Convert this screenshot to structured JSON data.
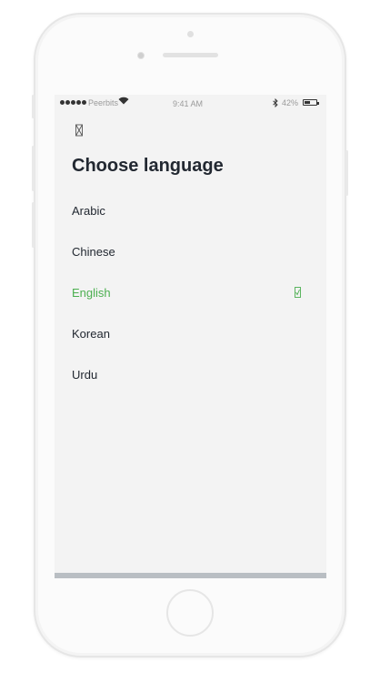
{
  "status_bar": {
    "carrier": "Peerbits",
    "time": "9:41 AM",
    "battery": "42%",
    "bluetooth_icon": "bluetooth-icon",
    "wifi_icon": "wifi-icon"
  },
  "nav": {
    "back_icon": "back-icon"
  },
  "page": {
    "title": "Choose language"
  },
  "languages": [
    {
      "label": "Arabic",
      "selected": false
    },
    {
      "label": "Chinese",
      "selected": false
    },
    {
      "label": "English",
      "selected": true
    },
    {
      "label": "Korean",
      "selected": false
    },
    {
      "label": "Urdu",
      "selected": false
    }
  ],
  "colors": {
    "accent": "#4caf50",
    "text": "#222831",
    "screen_bg": "#f3f3f3"
  }
}
